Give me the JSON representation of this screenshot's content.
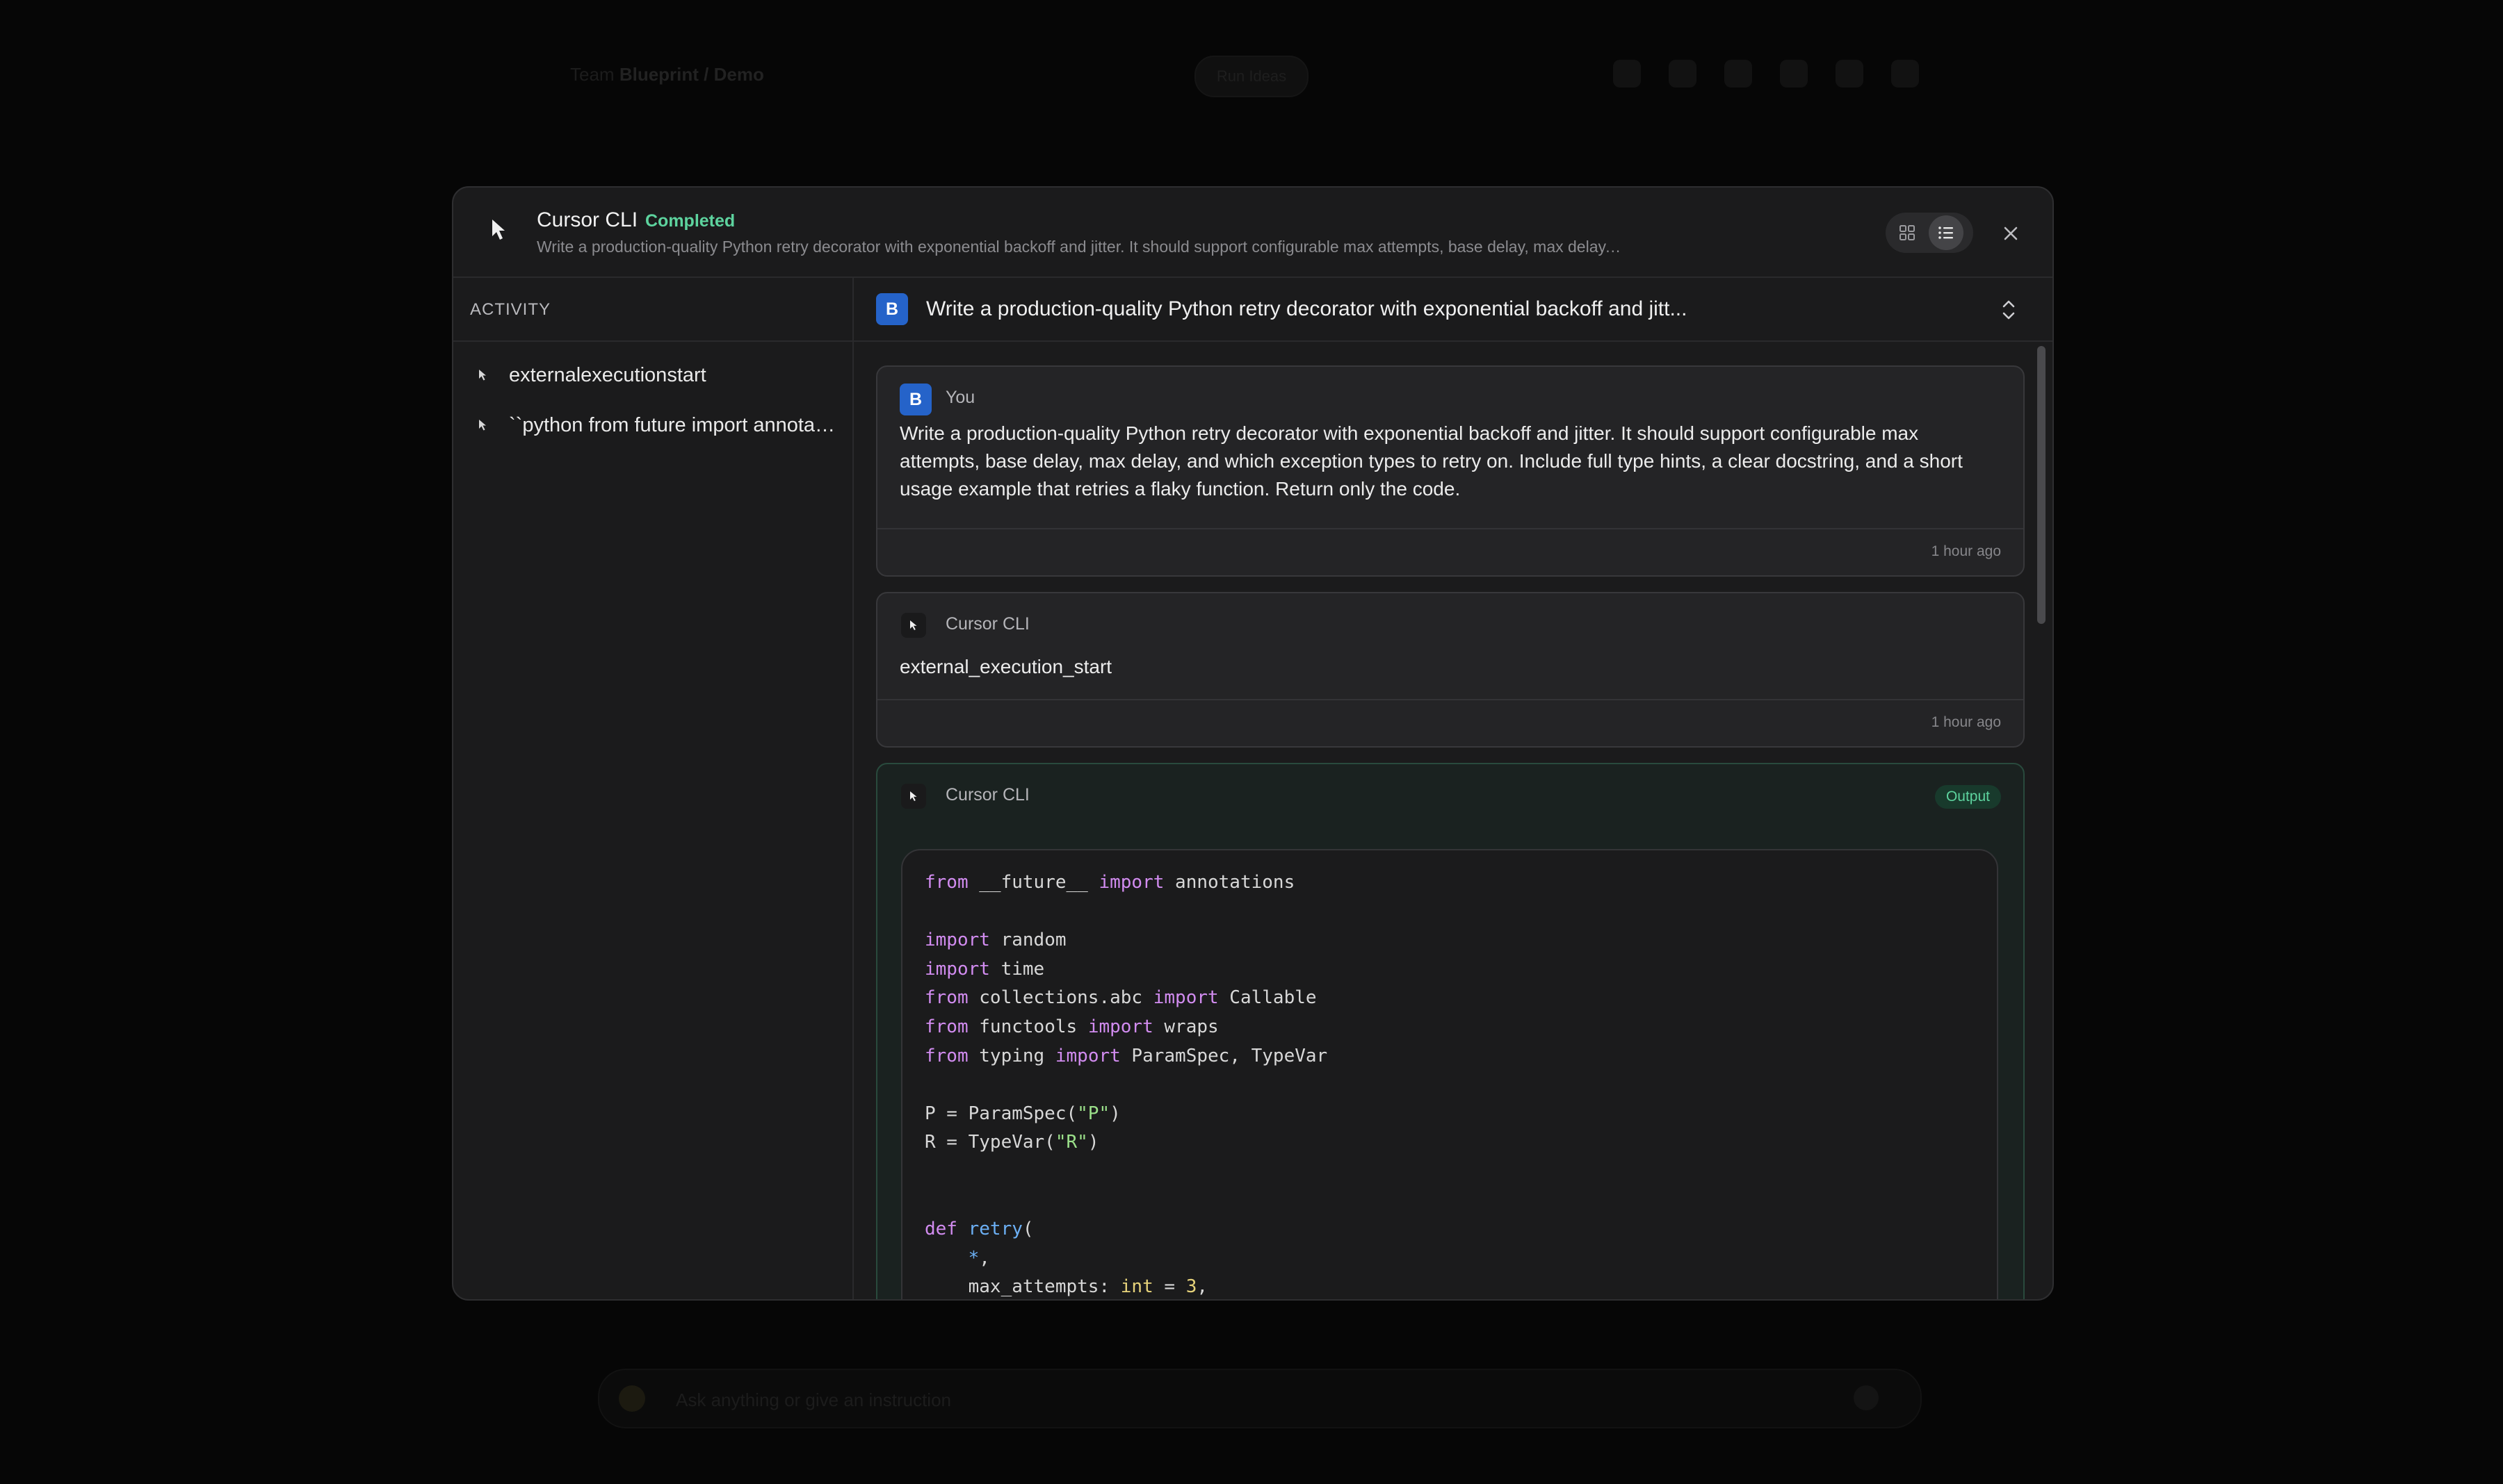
{
  "background": {
    "breadcrumb_prefix": "Team",
    "breadcrumb_current": "Blueprint / Demo",
    "pill": "Run Ideas",
    "composer_placeholder": "Ask anything or give an instruction"
  },
  "modal": {
    "title": "Cursor CLI",
    "status": "Completed",
    "subtitle": "Write a production-quality Python retry decorator with exponential backoff and jitter. It should support configurable max attempts, base delay, max delay, and which exception types to retry on. Include full type hints, a clear docstring, and a short usage example that retries a flaky function. Return only the code.",
    "view_modes": [
      "grid-view",
      "list-view"
    ],
    "active_view": "list-view"
  },
  "sidebar": {
    "heading": "ACTIVITY",
    "items": [
      {
        "label": "externalexecutionstart"
      },
      {
        "label": "``python from future import annotations"
      }
    ]
  },
  "main": {
    "avatar": "B",
    "title": "Write a production-quality Python retry decorator with exponential backoff and jitt..."
  },
  "messages": [
    {
      "avatar": "B",
      "author": "You",
      "text": "Write a production-quality Python retry decorator with exponential backoff and jitter. It should support configurable max attempts, base delay, max delay, and which exception types to retry on. Include full type hints, a clear docstring, and a short usage example that retries a flaky function. Return only the code.",
      "time": "1 hour ago"
    },
    {
      "author": "Cursor CLI",
      "text": "external_execution_start",
      "time": "1 hour ago"
    },
    {
      "author": "Cursor CLI",
      "badge": "Output"
    }
  ],
  "colors": {
    "accent_green": "#5dd39e",
    "avatar_blue": "#2563c9",
    "keyword": "#d28cf0",
    "string": "#9be08a",
    "function": "#6cb0f5"
  }
}
